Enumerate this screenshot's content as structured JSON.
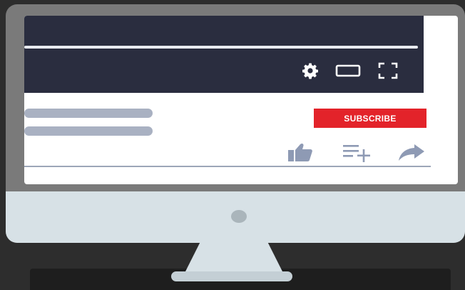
{
  "player": {
    "controls": [
      {
        "name": "settings",
        "icon": "gear-icon"
      },
      {
        "name": "theater-mode",
        "icon": "theater-mode-icon"
      },
      {
        "name": "fullscreen",
        "icon": "fullscreen-icon"
      }
    ]
  },
  "channel": {
    "subscribe_label": "SUBSCRIBE"
  },
  "actions": [
    {
      "name": "like",
      "icon": "thumbs-up-icon"
    },
    {
      "name": "add-to-playlist",
      "icon": "playlist-add-icon"
    },
    {
      "name": "share",
      "icon": "share-arrow-icon"
    }
  ],
  "colors": {
    "player_bg": "#2a2d3f",
    "subscribe_red": "#e3232a",
    "placeholder_gray": "#a9b1c2",
    "action_icon": "#8e9ab4",
    "bezel": "#7a7a7a",
    "chin": "#d7e1e6"
  }
}
